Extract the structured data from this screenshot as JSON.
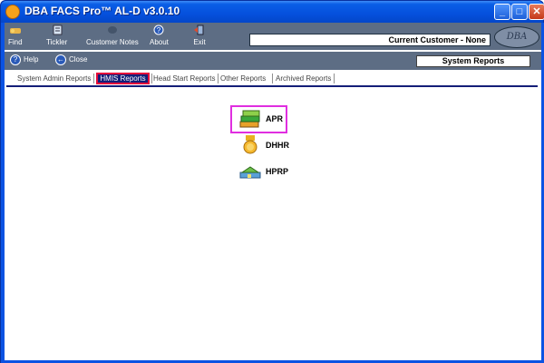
{
  "window": {
    "title": "DBA FACS Pro™ AL-D v3.0.10",
    "controls": {
      "minimize": "_",
      "maximize": "□",
      "close": "✕"
    }
  },
  "toolbar": {
    "items": [
      {
        "label": "Find",
        "icon": "find-icon"
      },
      {
        "label": "Tickler",
        "icon": "tickler-icon"
      },
      {
        "label": "Customer Notes",
        "icon": "notes-icon"
      },
      {
        "label": "About",
        "icon": "about-icon"
      },
      {
        "label": "Exit",
        "icon": "exit-icon"
      }
    ],
    "customer": "Current Customer - None",
    "logo_text": "DBA"
  },
  "nav": {
    "help_label": "Help",
    "close_label": "Close",
    "section_title": "System Reports"
  },
  "tabs": [
    {
      "label": "System Admin Reports"
    },
    {
      "label": "HMIS Reports"
    },
    {
      "label": "Head Start Reports"
    },
    {
      "label": "Other Reports"
    },
    {
      "label": "Archived Reports"
    }
  ],
  "active_tab": "HMIS Reports",
  "reports": [
    {
      "label": "APR",
      "icon": "books-icon"
    },
    {
      "label": "DHHR",
      "icon": "medal-icon"
    },
    {
      "label": "HPRP",
      "icon": "house-icon"
    }
  ],
  "colors": {
    "title_bar": "#0550dd",
    "toolbar_bg": "#5d6d84",
    "active_tab_bg": "#141e78",
    "active_tab_border": "#e60b3a",
    "highlight_frame": "#e02ee0"
  }
}
